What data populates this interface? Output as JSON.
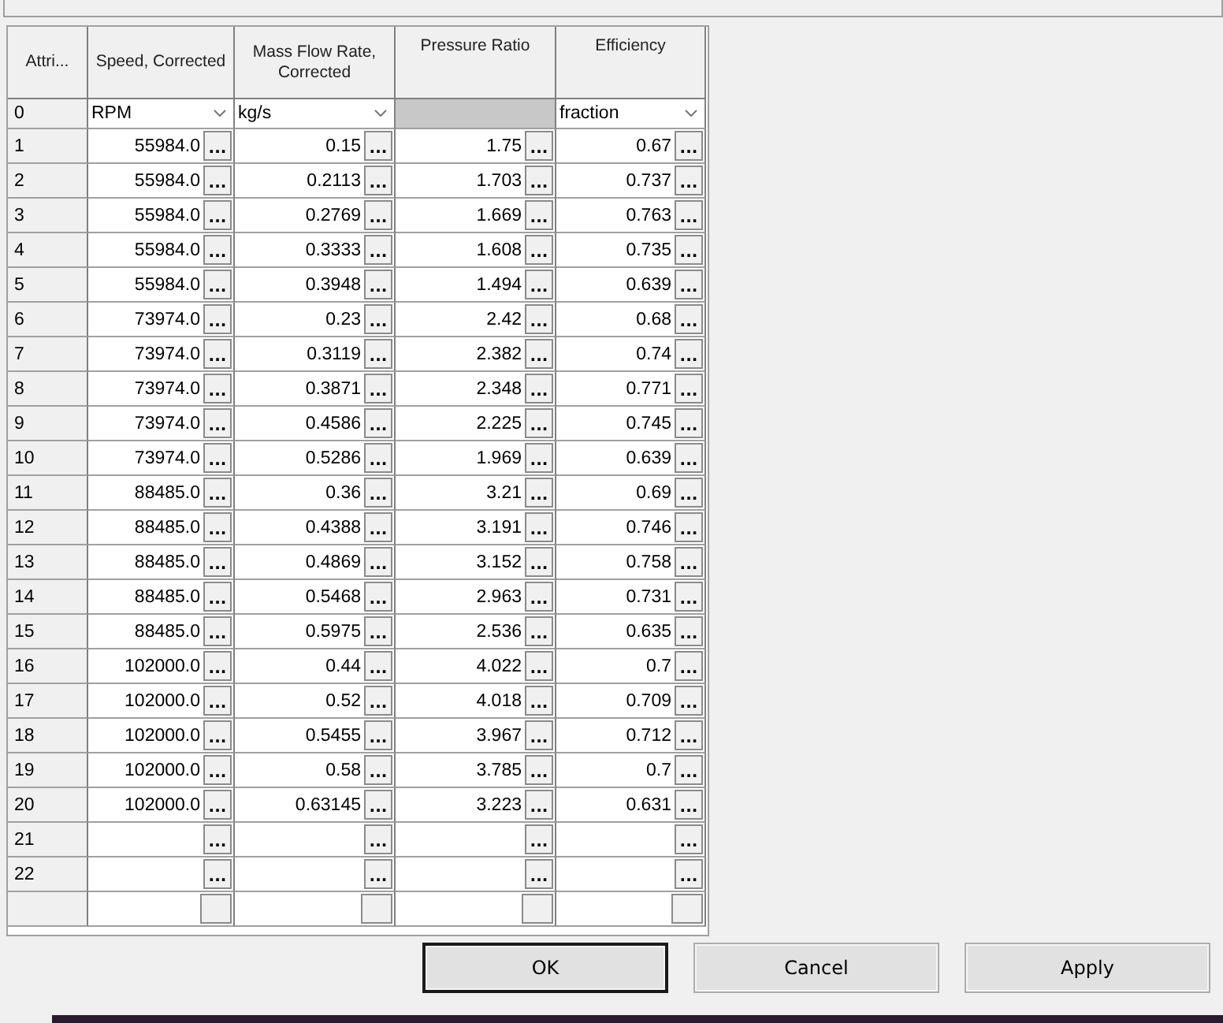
{
  "table": {
    "columns": [
      "Attri...",
      "Speed, Corrected",
      "Mass Flow Rate, Corrected",
      "Pressure Ratio",
      "Efficiency"
    ],
    "units_row": {
      "index": "0",
      "cells": [
        {
          "kind": "dropdown",
          "text": "RPM"
        },
        {
          "kind": "dropdown",
          "text": "kg/s"
        },
        {
          "kind": "blank"
        },
        {
          "kind": "dropdown",
          "text": "fraction"
        }
      ]
    },
    "rows": [
      {
        "index": "1",
        "values": [
          "55984.0",
          "0.15",
          "1.75",
          "0.67"
        ]
      },
      {
        "index": "2",
        "values": [
          "55984.0",
          "0.2113",
          "1.703",
          "0.737"
        ]
      },
      {
        "index": "3",
        "values": [
          "55984.0",
          "0.2769",
          "1.669",
          "0.763"
        ]
      },
      {
        "index": "4",
        "values": [
          "55984.0",
          "0.3333",
          "1.608",
          "0.735"
        ]
      },
      {
        "index": "5",
        "values": [
          "55984.0",
          "0.3948",
          "1.494",
          "0.639"
        ]
      },
      {
        "index": "6",
        "values": [
          "73974.0",
          "0.23",
          "2.42",
          "0.68"
        ]
      },
      {
        "index": "7",
        "values": [
          "73974.0",
          "0.3119",
          "2.382",
          "0.74"
        ]
      },
      {
        "index": "8",
        "values": [
          "73974.0",
          "0.3871",
          "2.348",
          "0.771"
        ]
      },
      {
        "index": "9",
        "values": [
          "73974.0",
          "0.4586",
          "2.225",
          "0.745"
        ]
      },
      {
        "index": "10",
        "values": [
          "73974.0",
          "0.5286",
          "1.969",
          "0.639"
        ]
      },
      {
        "index": "11",
        "values": [
          "88485.0",
          "0.36",
          "3.21",
          "0.69"
        ]
      },
      {
        "index": "12",
        "values": [
          "88485.0",
          "0.4388",
          "3.191",
          "0.746"
        ]
      },
      {
        "index": "13",
        "values": [
          "88485.0",
          "0.4869",
          "3.152",
          "0.758"
        ]
      },
      {
        "index": "14",
        "values": [
          "88485.0",
          "0.5468",
          "2.963",
          "0.731"
        ]
      },
      {
        "index": "15",
        "values": [
          "88485.0",
          "0.5975",
          "2.536",
          "0.635"
        ]
      },
      {
        "index": "16",
        "values": [
          "102000.0",
          "0.44",
          "4.022",
          "0.7"
        ]
      },
      {
        "index": "17",
        "values": [
          "102000.0",
          "0.52",
          "4.018",
          "0.709"
        ]
      },
      {
        "index": "18",
        "values": [
          "102000.0",
          "0.5455",
          "3.967",
          "0.712"
        ]
      },
      {
        "index": "19",
        "values": [
          "102000.0",
          "0.58",
          "3.785",
          "0.7"
        ]
      },
      {
        "index": "20",
        "values": [
          "102000.0",
          "0.63145",
          "3.223",
          "0.631"
        ]
      },
      {
        "index": "21"
      },
      {
        "index": "22"
      },
      {
        "kind": "cut"
      }
    ],
    "edit_button": "..."
  },
  "buttons": [
    {
      "label": "OK",
      "default": true
    },
    {
      "label": "Cancel",
      "default": false
    },
    {
      "label": "Apply",
      "default": false
    }
  ]
}
